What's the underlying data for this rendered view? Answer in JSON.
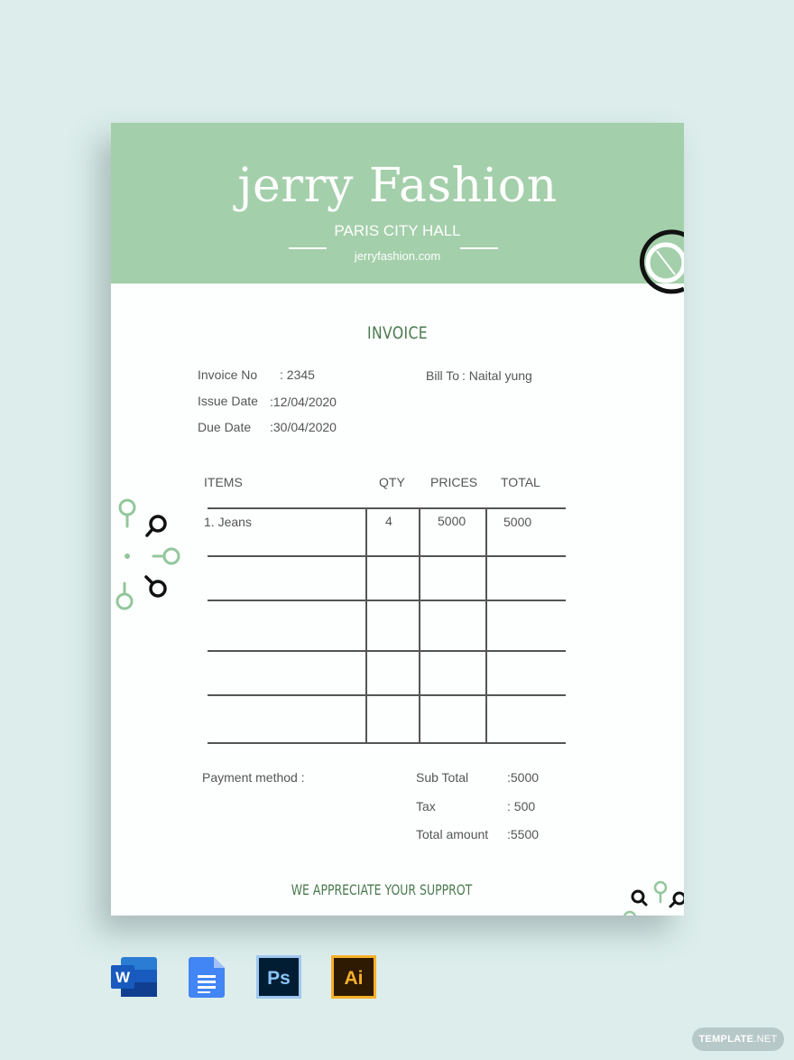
{
  "header": {
    "brand_name": "jerry Fashion",
    "location": "PARIS CITY HALL",
    "website": "jerryfashion.com"
  },
  "invoice": {
    "title": "INVOICE",
    "invoice_no_label": "Invoice No",
    "invoice_no_value": ": 2345",
    "issue_date_label": "Issue Date",
    "issue_date_value": ":12/04/2020",
    "due_date_label": "Due Date",
    "due_date_value": ":30/04/2020",
    "bill_to_label": "Bill To",
    "bill_to_value": ": Naital yung"
  },
  "table": {
    "headers": [
      "ITEMS",
      "QTY",
      "PRICES",
      "TOTAL"
    ],
    "rows": [
      {
        "item": "1. Jeans",
        "qty": "4",
        "price": "5000",
        "total": "5000"
      },
      {
        "item": "",
        "qty": "",
        "price": "",
        "total": ""
      },
      {
        "item": "",
        "qty": "",
        "price": "",
        "total": ""
      },
      {
        "item": "",
        "qty": "",
        "price": "",
        "total": ""
      },
      {
        "item": "",
        "qty": "",
        "price": "",
        "total": ""
      }
    ]
  },
  "summary": {
    "payment_method_label": "Payment method :",
    "sub_total_label": "Sub Total",
    "sub_total_value": ":5000",
    "tax_label": "Tax",
    "tax_value": ": 500",
    "total_amount_label": "Total amount",
    "total_amount_value": ":5500"
  },
  "footer": {
    "thanks": "WE APPRECIATE YOUR SUPPROT"
  },
  "formats": [
    {
      "name": "Word",
      "glyph": "W",
      "color": "#185abd"
    },
    {
      "name": "Google Docs",
      "glyph": "",
      "color": "#4285f4"
    },
    {
      "name": "Photoshop",
      "glyph": "Ps",
      "color": "#001d34"
    },
    {
      "name": "Illustrator",
      "glyph": "Ai",
      "color": "#2e1a02"
    }
  ],
  "watermark": {
    "brand": "TEMPLATE",
    "suffix": ".NET"
  },
  "colors": {
    "header_green": "#a3cfaa",
    "title_green": "#4a7a4e",
    "background": "#dcedeb"
  }
}
